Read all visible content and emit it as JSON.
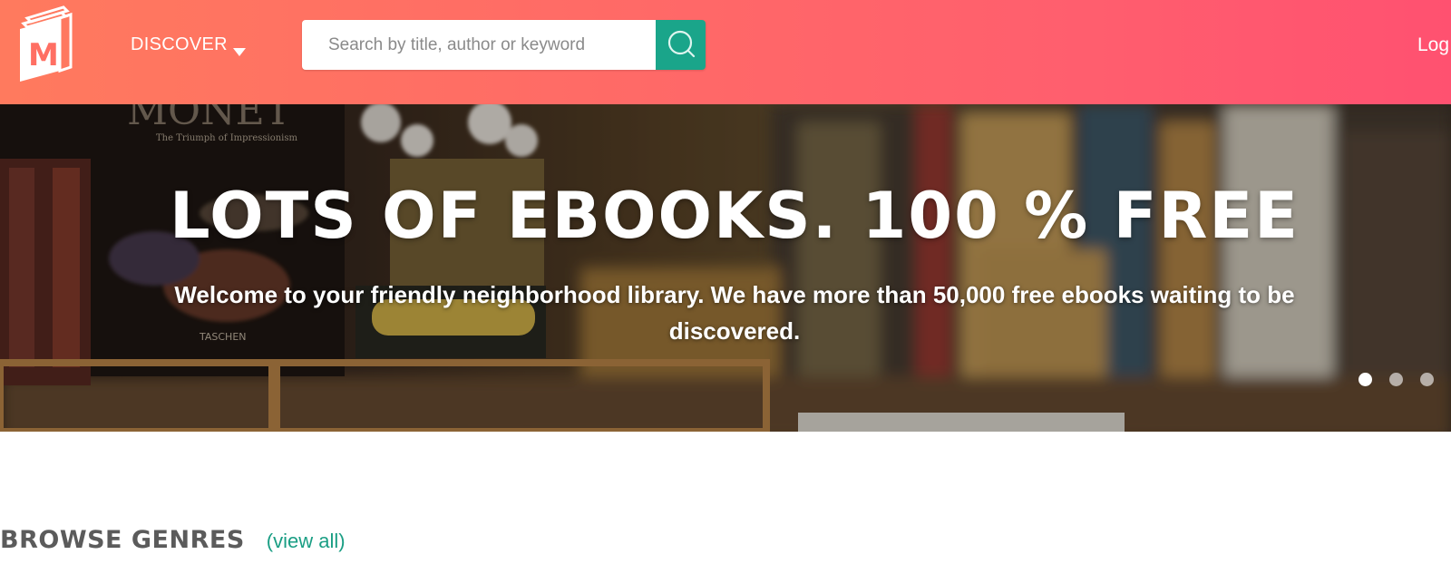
{
  "header": {
    "logo_letter": "M",
    "discover_label": "DISCOVER",
    "search": {
      "placeholder": "Search by title, author or keyword",
      "value": ""
    },
    "login_label": "Log"
  },
  "hero": {
    "title": "LOTS OF EBOOKS. 100 % FREE",
    "subtitle": "Welcome to your friendly neighborhood library. We have more than 50,000 free ebooks waiting to be discovered.",
    "book_title": "MONET",
    "book_subtitle": "The Triumph of Impressionism",
    "book_publisher": "TASCHEN",
    "carousel": {
      "slide_count": 3,
      "active_slide": 1
    }
  },
  "browse": {
    "title": "BROWSE GENRES",
    "view_all_label": "(view all)"
  },
  "colors": {
    "header_gradient_start": "#ff7a5e",
    "header_gradient_end": "#ff5170",
    "search_button": "#1aa58a",
    "link": "#1a9e84",
    "heading_text": "#5b5b5b"
  },
  "icons": {
    "logo": "book-logo-icon",
    "discover_caret": "caret-down-icon",
    "search": "search-icon"
  }
}
